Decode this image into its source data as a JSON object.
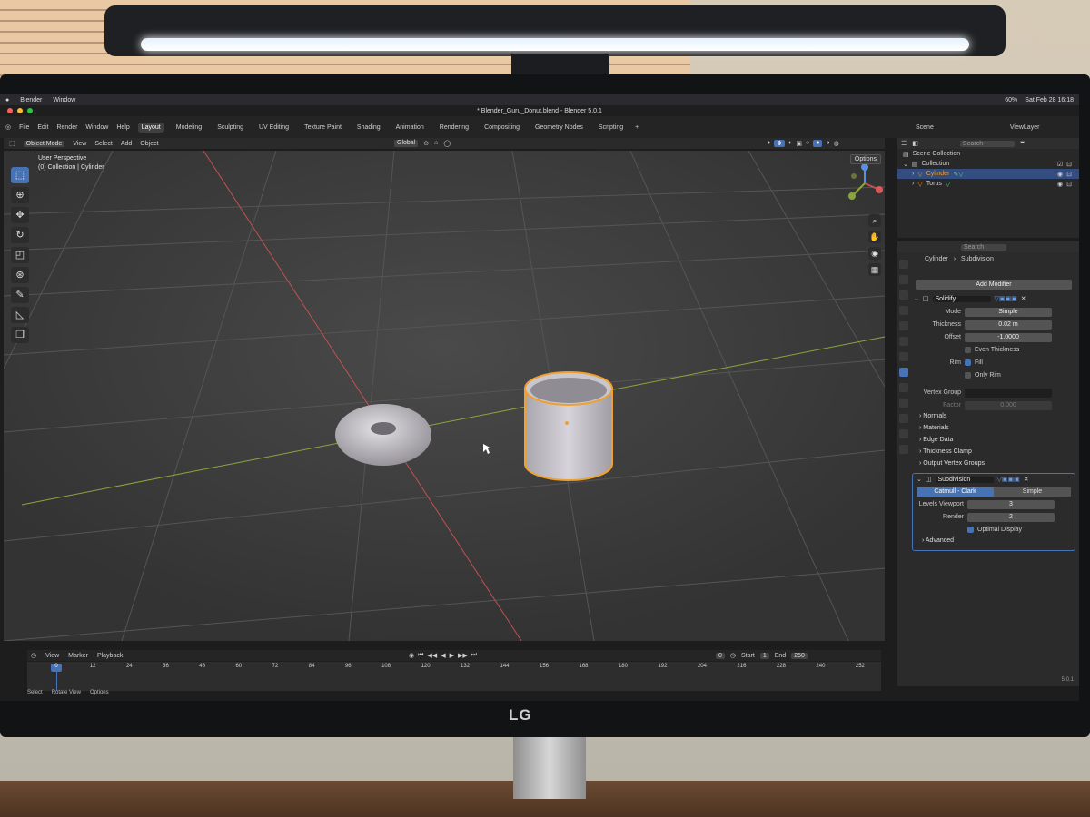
{
  "mac_menu": {
    "app": "Blender",
    "window": "Window",
    "date": "Sat Feb 28 16:18",
    "battery": "60%"
  },
  "window_title": "* Blender_Guru_Donut.blend - Blender 5.0.1",
  "menu": [
    "File",
    "Edit",
    "Render",
    "Window",
    "Help"
  ],
  "workspaces": [
    {
      "label": "Layout",
      "active": true
    },
    {
      "label": "Modeling"
    },
    {
      "label": "Sculpting"
    },
    {
      "label": "UV Editing"
    },
    {
      "label": "Texture Paint"
    },
    {
      "label": "Shading"
    },
    {
      "label": "Animation"
    },
    {
      "label": "Rendering"
    },
    {
      "label": "Compositing"
    },
    {
      "label": "Geometry Nodes"
    },
    {
      "label": "Scripting"
    }
  ],
  "scene": {
    "scene_name": "Scene",
    "view_layer": "ViewLayer"
  },
  "viewport_header": {
    "mode": "Object Mode",
    "view": "View",
    "select": "Select",
    "add": "Add",
    "object": "Object",
    "transform": "Global"
  },
  "viewport": {
    "perspective": "User Perspective",
    "context": "(0) Collection | Cylinder",
    "options": "Options"
  },
  "outliner": {
    "search_placeholder": "Search",
    "scene_collection": "Scene Collection",
    "collection": "Collection",
    "items": [
      {
        "name": "Cylinder",
        "selected": true
      },
      {
        "name": "Torus",
        "selected": false
      }
    ]
  },
  "properties": {
    "search_placeholder": "Search",
    "object": "Cylinder",
    "modifier": "Subdivision",
    "add_modifier": "Add Modifier",
    "solidify": {
      "name": "Solidify",
      "mode_label": "Mode",
      "mode": "Simple",
      "thickness_label": "Thickness",
      "thickness": "0.02 m",
      "offset_label": "Offset",
      "offset": "-1.0000",
      "even_thickness": "Even Thickness",
      "rim_label": "Rim",
      "fill": "Fill",
      "only_rim": "Only Rim",
      "vertex_group_label": "Vertex Group",
      "factor_label": "Factor",
      "factor": "0.000",
      "subpanels": [
        "Normals",
        "Materials",
        "Edge Data",
        "Thickness Clamp",
        "Output Vertex Groups"
      ]
    },
    "subdivision": {
      "name": "Subdivision",
      "catmull": "Catmull - Clark",
      "simple": "Simple",
      "levels_label": "Levels Viewport",
      "levels": "3",
      "render_label": "Render",
      "render": "2",
      "optimal": "Optimal Display",
      "advanced": "Advanced"
    }
  },
  "timeline": {
    "view": "View",
    "marker": "Marker",
    "playback": "Playback",
    "current_frame": "0",
    "start_label": "Start",
    "start": "1",
    "end_label": "End",
    "end": "250",
    "ticks": [
      "0",
      "12",
      "24",
      "36",
      "48",
      "60",
      "72",
      "84",
      "96",
      "108",
      "120",
      "132",
      "144",
      "156",
      "168",
      "180",
      "192",
      "204",
      "216",
      "228",
      "240",
      "252"
    ],
    "playhead": "0"
  },
  "statusbar": {
    "select": "Select",
    "rotate": "Rotate View",
    "options": "Options"
  },
  "version": "5.0.1",
  "monitor_logo": "LG"
}
